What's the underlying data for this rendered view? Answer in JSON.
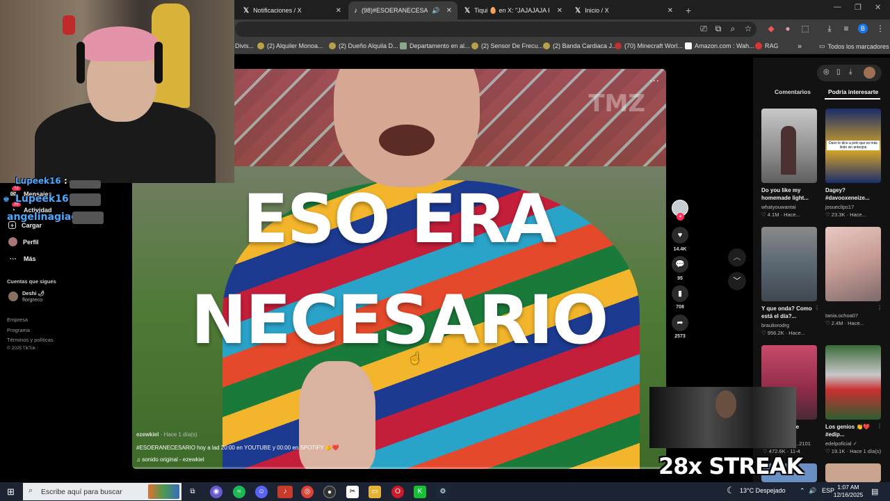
{
  "browser": {
    "tabs": [
      {
        "title": "Notificaciones / X",
        "favicon": "x-logo"
      },
      {
        "title": "(98)#ESOERANECESARIO h",
        "favicon": "tiktok-logo",
        "active": true
      },
      {
        "title": "Tiqui 🥚 en X: \"JAJAJAJA PO",
        "favicon": "x-logo"
      },
      {
        "title": "Inicio / X",
        "favicon": "x-logo"
      }
    ],
    "new_tab": "+",
    "profile_initial": "B",
    "bookmarks": [
      {
        "label": "Divis..."
      },
      {
        "label": "(2) Alquiler Monoa..."
      },
      {
        "label": "(2) Dueño Alquila D..."
      },
      {
        "label": "Departamento en al..."
      },
      {
        "label": "(2) Sensor De Frecu..."
      },
      {
        "label": "(2) Banda Cardiaca J..."
      },
      {
        "label": "(70) Minecraft Worl..."
      },
      {
        "label": "Amazon.com : Wah..."
      },
      {
        "label": "RAG"
      }
    ],
    "bookmarks_overflow": "»",
    "all_bookmarks": "Todos los marcadores"
  },
  "sidebar": {
    "items": [
      {
        "label": "Mensajes",
        "badge": "72",
        "icon": "message-icon"
      },
      {
        "label": "Actividad",
        "badge": "35",
        "icon": "activity-icon"
      },
      {
        "label": "Cargar",
        "icon": "upload-icon"
      },
      {
        "label": "Perfil",
        "icon": "profile-icon"
      },
      {
        "label": "Más",
        "icon": "more-icon"
      }
    ],
    "following_header": "Cuentas que sigues",
    "following": [
      {
        "name": "Deshi 🌶",
        "handle": "florgreco"
      }
    ],
    "footer": [
      "Empresa",
      "Programa",
      "Términos y políticas",
      "© 2025 TikTok"
    ]
  },
  "stream_chat": [
    {
      "name": "Lupeek16",
      "suffix": ":"
    },
    {
      "name": "Lupeek16",
      "suffix": ":"
    },
    {
      "name": "angelinagiag",
      "suffix": ":"
    }
  ],
  "video": {
    "overlay_line1": "ESO ERA",
    "overlay_line2": "NECESARIO",
    "watermark": "TMZ",
    "more": "···",
    "author": "ezewkiel",
    "posted": " · Hace 1 día(s)",
    "description": "#ESOERANECESARIO hoy a lad 20:00 en YOUTUBE y 00:00 en SPOTIFY 🫵❤️",
    "sound": "♫  sonido original - ezewkiel",
    "progress": 0.0
  },
  "actions": {
    "likes": "14.4K",
    "comments": "95",
    "saves": "708",
    "shares": "2573"
  },
  "right_panel": {
    "tabs": [
      "Comentarios",
      "Podría interesarte"
    ],
    "active_tab": 1,
    "cards": [
      {
        "title": "Do you like my homemade light...",
        "user": "whatyouwantai",
        "stats": "♡ 4.1M · Hace...",
        "thumb_text": ""
      },
      {
        "title": "Dagey? #davooxeneize...",
        "user": "josueclips17",
        "stats": "♡ 23.3K · Hace...",
        "thumb_text": "Davo le dice a pelo que es más lindo sin anteojos"
      },
      {
        "title": "Y que onda? Como está el día?...",
        "user": "brauliorodrg",
        "stats": "♡ 956.2K · Hace...",
        "thumb_text": ""
      },
      {
        "title": "",
        "user": "tania.ochoa07",
        "stats": "♡ 2.4M · Hace...",
        "thumb_text": ""
      },
      {
        "title": "...e",
        "user": "...2101",
        "stats": "♡ 472.6K · 11-4",
        "thumb_text": ""
      },
      {
        "title": "Los genios 👏❤️ #edip...",
        "user": "edelpoficial ✓",
        "stats": "♡ 19.1K · Hace 1 día(s)",
        "thumb_text": ""
      }
    ]
  },
  "stream_overlay": {
    "streak": "28x STREAK"
  },
  "taskbar": {
    "search_placeholder": "Escribe aquí para buscar",
    "weather": "13°C  Despejado",
    "language": "ESP",
    "time": "1:07 AM",
    "date": "12/16/2025"
  },
  "colors": {
    "tiktok_red": "#fe2c55",
    "chat_name": "#4aa8ff",
    "taskbar": "#1c2433"
  }
}
